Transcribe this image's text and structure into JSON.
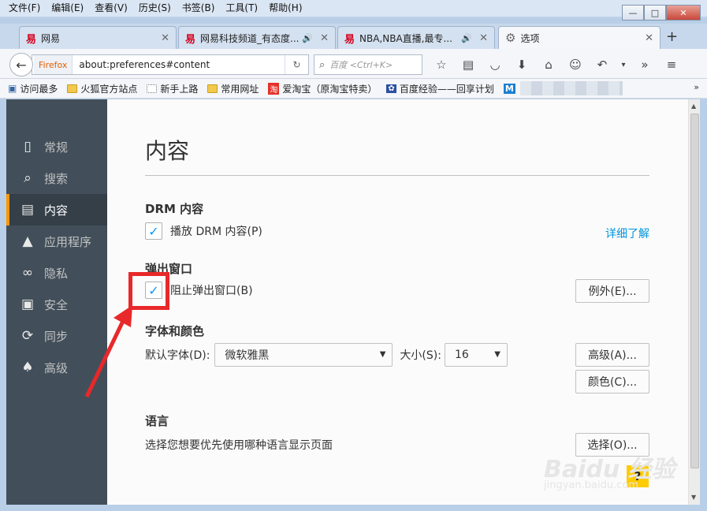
{
  "menu": [
    "文件(F)",
    "编辑(E)",
    "查看(V)",
    "历史(S)",
    "书签(B)",
    "工具(T)",
    "帮助(H)"
  ],
  "tabs": [
    {
      "label": "网易",
      "audio": false,
      "active": false
    },
    {
      "label": "网易科技频道_有态度...",
      "audio": true,
      "active": false
    },
    {
      "label": "NBA,NBA直播,最专...",
      "audio": true,
      "active": false
    },
    {
      "label": "选项",
      "audio": false,
      "active": true
    }
  ],
  "navbar": {
    "identity": "Firefox",
    "url": "about:preferences#content",
    "search_placeholder": "百度 <Ctrl+K>"
  },
  "bookmarks": [
    {
      "label": "访问最多",
      "icon": "page-icon"
    },
    {
      "label": "火狐官方站点",
      "icon": "folder-icon"
    },
    {
      "label": "新手上路",
      "icon": "dotted-folder-icon"
    },
    {
      "label": "常用网址",
      "icon": "folder-icon"
    },
    {
      "label": "爱淘宝（原淘宝特卖）",
      "icon": "taobao-icon"
    },
    {
      "label": "百度经验——回享计划",
      "icon": "paw-icon"
    }
  ],
  "sidebar": [
    {
      "label": "常规",
      "icon": "general-icon",
      "selected": false
    },
    {
      "label": "搜索",
      "icon": "search-icon",
      "selected": false
    },
    {
      "label": "内容",
      "icon": "content-icon",
      "selected": true
    },
    {
      "label": "应用程序",
      "icon": "rocket-icon",
      "selected": false
    },
    {
      "label": "隐私",
      "icon": "mask-icon",
      "selected": false
    },
    {
      "label": "安全",
      "icon": "lock-icon",
      "selected": false
    },
    {
      "label": "同步",
      "icon": "sync-icon",
      "selected": false
    },
    {
      "label": "高级",
      "icon": "wizard-icon",
      "selected": false
    }
  ],
  "main": {
    "title": "内容",
    "drm": {
      "heading": "DRM 内容",
      "checkbox": "播放 DRM 内容(P)",
      "checked": true,
      "learn_more": "详细了解"
    },
    "popups": {
      "heading": "弹出窗口",
      "checkbox": "阻止弹出窗口(B)",
      "checked": true,
      "exceptions": "例外(E)..."
    },
    "fonts": {
      "heading": "字体和颜色",
      "default_font_label": "默认字体(D):",
      "default_font_value": "微软雅黑",
      "size_label": "大小(S):",
      "size_value": "16",
      "advanced": "高级(A)...",
      "colors": "颜色(C)..."
    },
    "language": {
      "heading": "语言",
      "description": "选择您想要优先使用哪种语言显示页面",
      "choose": "选择(O)..."
    }
  },
  "help_label": "?",
  "watermark": {
    "main": "Baidu 经验",
    "sub": "jingyan.baidu.com"
  }
}
